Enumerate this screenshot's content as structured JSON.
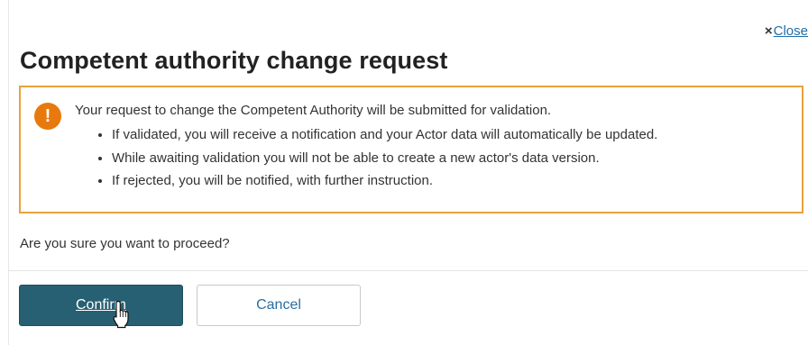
{
  "modal": {
    "close_label": "Close",
    "title": "Competent authority change request"
  },
  "warning": {
    "icon": "exclamation-icon",
    "icon_glyph": "!",
    "intro": "Your request to change the Competent Authority will be submitted for validation.",
    "items": [
      "If validated, you will receive a notification and your Actor data will automatically be updated.",
      "While awaiting validation you will not be able to create a new actor's data version.",
      "If rejected, you will be notified, with further instruction."
    ]
  },
  "question": "Are you sure you want to proceed?",
  "buttons": {
    "confirm": "Confirm",
    "cancel": "Cancel"
  },
  "colors": {
    "confirm_bg": "#275f73",
    "warning_border": "#e8a33c",
    "warning_icon": "#e8790d",
    "link": "#1f6ea8"
  }
}
